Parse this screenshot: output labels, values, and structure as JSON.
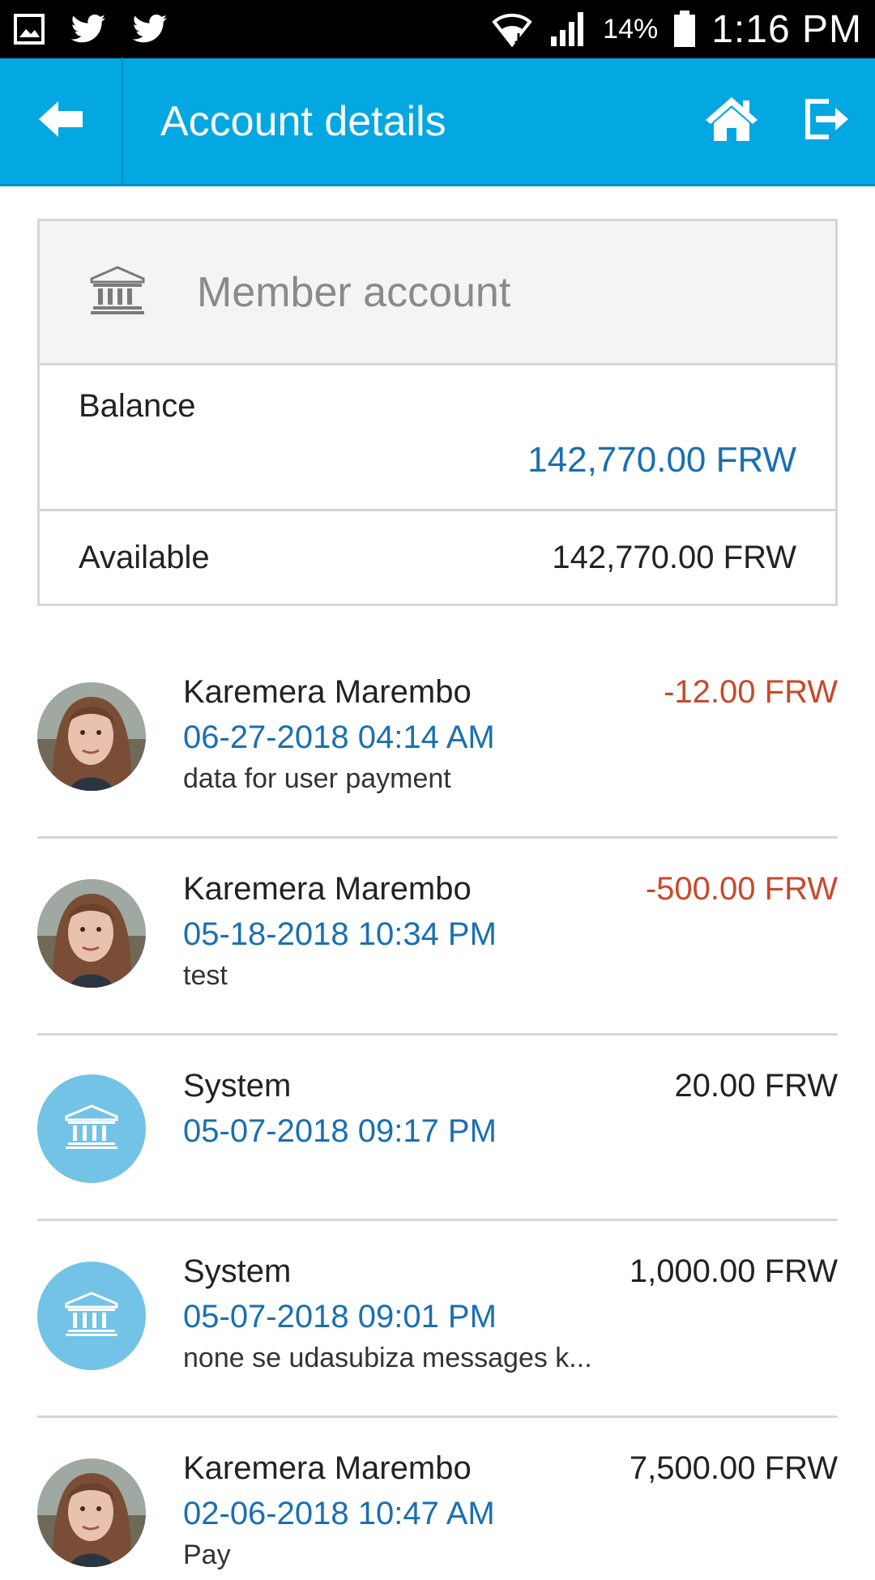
{
  "status_bar": {
    "battery": "14%",
    "time": "1:16 PM",
    "icons": [
      "gallery-icon",
      "twitter-icon",
      "twitter-icon",
      "wifi-icon",
      "signal-icon",
      "battery-icon"
    ]
  },
  "app_bar": {
    "title": "Account details",
    "color": "#03a7e1",
    "icons": [
      "back-arrow-icon",
      "home-icon",
      "logout-icon"
    ]
  },
  "account": {
    "type_label": "Member account",
    "balance_label": "Balance",
    "balance_value": "142,770.00 FRW",
    "available_label": "Available",
    "available_value": "142,770.00 FRW"
  },
  "colors": {
    "accent_blue": "#1a6fb2",
    "negative": "#c8492a",
    "bank_avatar": "#73c3e6"
  },
  "transactions": [
    {
      "name": "Karemera Marembo",
      "date": "06-27-2018 04:14 AM",
      "description": "data for user payment",
      "amount": "-12.00 FRW",
      "avatar": "photo"
    },
    {
      "name": "Karemera Marembo",
      "date": "05-18-2018 10:34 PM",
      "description": "test",
      "amount": "-500.00 FRW",
      "avatar": "photo"
    },
    {
      "name": "System",
      "date": "05-07-2018 09:17 PM",
      "description": "",
      "amount": "20.00 FRW",
      "avatar": "bank-icon"
    },
    {
      "name": "System",
      "date": "05-07-2018 09:01 PM",
      "description": "none se udasubiza messages k...",
      "amount": "1,000.00 FRW",
      "avatar": "bank-icon"
    },
    {
      "name": "Karemera Marembo",
      "date": "02-06-2018 10:47 AM",
      "description": "Pay",
      "amount": "7,500.00 FRW",
      "avatar": "photo"
    }
  ]
}
